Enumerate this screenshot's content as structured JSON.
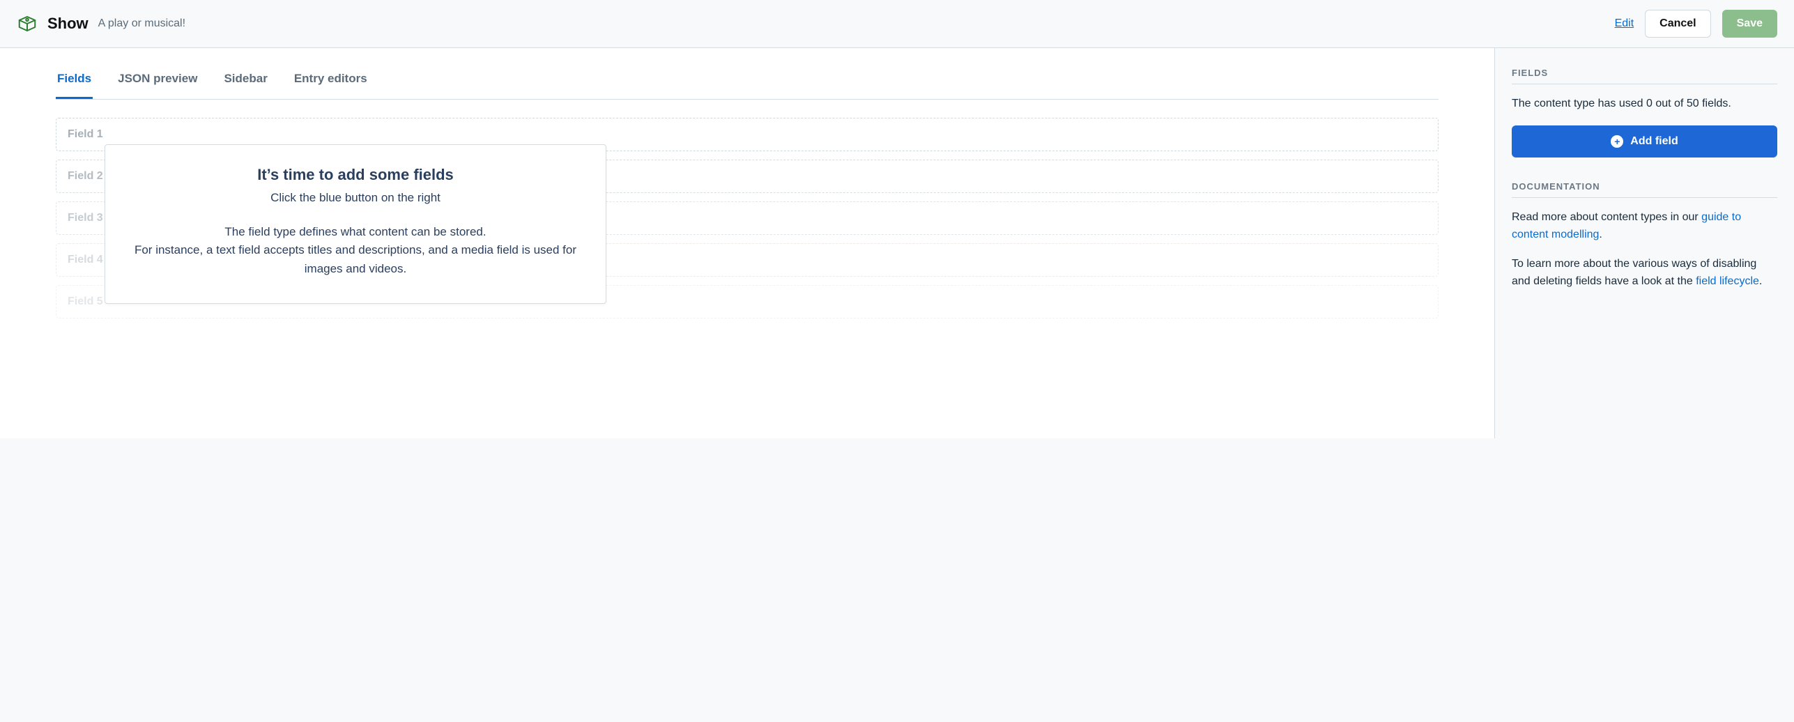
{
  "header": {
    "title": "Show",
    "subtitle": "A play or musical!",
    "edit_label": "Edit",
    "cancel_label": "Cancel",
    "save_label": "Save"
  },
  "tabs": {
    "fields": "Fields",
    "json_preview": "JSON preview",
    "sidebar": "Sidebar",
    "entry_editors": "Entry editors"
  },
  "placeholder_fields": {
    "f1": "Field 1",
    "f2": "Field 2",
    "f3": "Field 3",
    "f4": "Field 4",
    "f5": "Field 5"
  },
  "onboarding": {
    "title": "It’s time to add some fields",
    "lead": "Click the blue button on the right",
    "desc_line1": "The field type defines what content can be stored.",
    "desc_line2": "For instance, a text field accepts titles and descriptions, and a media field is used for images and videos."
  },
  "sidebar": {
    "fields_heading": "FIELDS",
    "fields_usage": "The content type has used 0 out of 50 fields.",
    "add_field_label": "Add field",
    "docs_heading": "DOCUMENTATION",
    "docs_intro_prefix": "Read more about content types in our ",
    "docs_guide_link": "guide to content modelling",
    "docs_lifecycle_prefix": "To learn more about the various ways of disabling and deleting fields have a look at the ",
    "docs_lifecycle_link": "field lifecycle",
    "period": "."
  }
}
